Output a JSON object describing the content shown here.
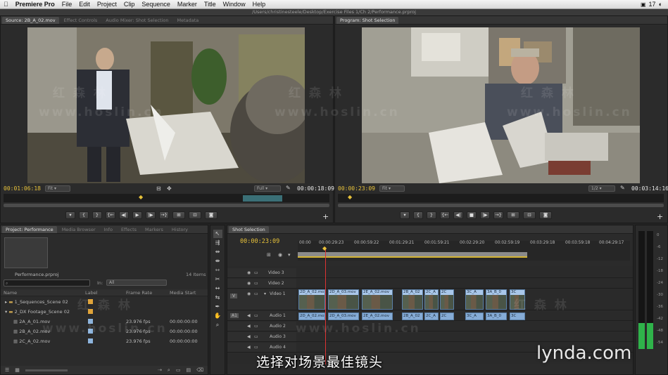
{
  "menubar": {
    "app": "Premiere Pro",
    "items": [
      "File",
      "Edit",
      "Project",
      "Clip",
      "Sequence",
      "Marker",
      "Title",
      "Window",
      "Help"
    ],
    "right_badge": "17"
  },
  "window_title": "/Users/christinesteele/Desktop/Exercise Files 1/Ch 2/Performance.prproj",
  "source_panel": {
    "tabs": [
      "Source: 2B_A_02.mov",
      "Effect Controls",
      "Audio Mixer: Shot Selection",
      "Metadata"
    ],
    "timecode_in": "00:01:06:18",
    "fit": "Fit",
    "quality": "Full",
    "timecode_out": "00:00:18:09"
  },
  "program_panel": {
    "tabs": [
      "Program: Shot Selection"
    ],
    "timecode_in": "00:00:23:09",
    "fit": "Fit",
    "quality": "1/2",
    "timecode_out": "00:03:14:16"
  },
  "project_panel": {
    "tabs": [
      "Project: Performance",
      "Media Browser",
      "Info",
      "Effects",
      "Markers",
      "History"
    ],
    "project_file": "Performance.prproj",
    "item_count": "14 Items",
    "search_placeholder": "",
    "in_label": "In:",
    "in_value": "All",
    "columns": [
      "Name",
      "Label",
      "Frame Rate",
      "Media Start"
    ],
    "rows": [
      {
        "name": "1_Sequences_Scene 02",
        "label_color": "#e0a43a",
        "frame_rate": "",
        "media_start": "",
        "type": "bin"
      },
      {
        "name": "2_DX Footage_Scene 02",
        "label_color": "#e0a43a",
        "frame_rate": "",
        "media_start": "",
        "type": "bin-open"
      },
      {
        "name": "2A_A_01.mov",
        "label_color": "#8db4dd",
        "frame_rate": "23.976 fps",
        "media_start": "00:00:00:00",
        "type": "clip"
      },
      {
        "name": "2B_A_02.mov",
        "label_color": "#8db4dd",
        "frame_rate": "23.976 fps",
        "media_start": "00:00:00:00",
        "type": "clip"
      },
      {
        "name": "2C_A_02.mov",
        "label_color": "#8db4dd",
        "frame_rate": "23.976 fps",
        "media_start": "00:00:00:00",
        "type": "clip"
      }
    ]
  },
  "timeline": {
    "tab": "Shot Selection",
    "timecode": "00:00:23:09",
    "ruler": [
      "00:00",
      "00:00:29:23",
      "00:00:59:22",
      "00:01:29:21",
      "00:01:59:21",
      "00:02:29:20",
      "00:02:59:19",
      "00:03:29:18",
      "00:03:59:18",
      "00:04:29:17"
    ],
    "video_tracks": [
      "Video 3",
      "Video 2",
      "Video 1"
    ],
    "audio_tracks": [
      "Audio 1",
      "Audio 2",
      "Audio 3",
      "Audio 4"
    ],
    "v_target": "V",
    "a_target": "A1",
    "video_clips": [
      "2D_A_02.mo",
      "2D_A_03.mov",
      "2E_A_02.mov",
      "2B_A_02",
      "2C_A",
      "2C",
      "3C_A",
      "3A_B_0",
      "3C"
    ],
    "audio_clips": [
      "2D_A_02.mo",
      "2D_A_03.mov",
      "2E_A_02.mov",
      "2B_A_02",
      "2C_A",
      "2C",
      "3C_A",
      "3A_B_0",
      "3C"
    ]
  },
  "audio_meter": {
    "scale": [
      "0",
      "-6",
      "-12",
      "-18",
      "-24",
      "-30",
      "-36",
      "-42",
      "-48",
      "-54"
    ],
    "level_db": -42
  },
  "overlay": {
    "subtitle": "选择对场景最佳镜头",
    "watermark_cn": "红 森 林",
    "watermark_url": "www.hoslin.cn",
    "brand": "lynda.com"
  }
}
